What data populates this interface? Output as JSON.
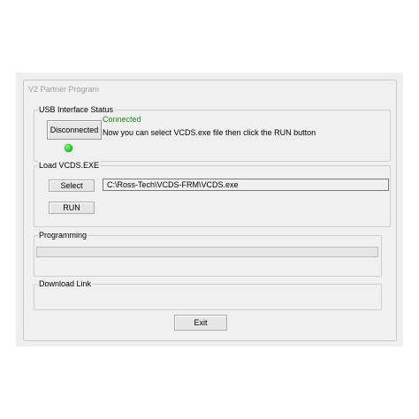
{
  "window": {
    "title": "V2 Partner Program"
  },
  "usb_status": {
    "group_label": "USB Interface Status",
    "button_label": "Disconnected",
    "status_text": "Connected",
    "message": "Now you can select VCDS.exe file then click the RUN button",
    "led_color": "#1ec81e"
  },
  "load": {
    "group_label": "Load VCDS.EXE",
    "select_label": "Select",
    "run_label": "RUN",
    "path_value": "C:\\Ross-Tech\\VCDS-FRM\\VCDS.exe"
  },
  "programming": {
    "group_label": "Programming",
    "progress_fraction": 0
  },
  "download": {
    "group_label": "Download Link"
  },
  "footer": {
    "exit_label": "Exit"
  }
}
